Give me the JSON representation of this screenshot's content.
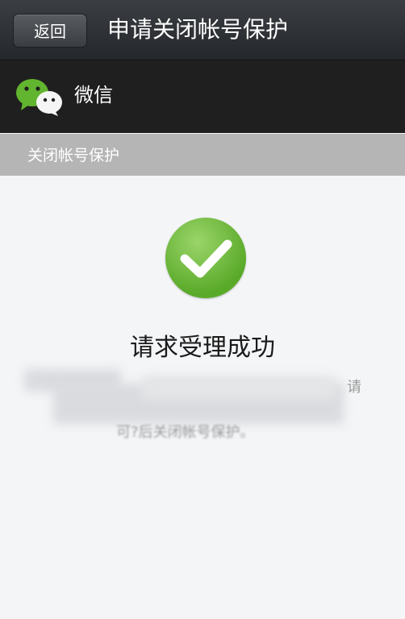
{
  "topbar": {
    "back_label": "返回",
    "title": "申请关闭帐号保护"
  },
  "appbar": {
    "app_name": "微信",
    "logo_icon": "wechat-logo-icon"
  },
  "section": {
    "label": "关闭帐号保护"
  },
  "result": {
    "icon": "check-circle-icon",
    "title": "请求受理成功",
    "desc_line1_tail": "请",
    "desc_line3": "可?后关闭帐号保护。"
  },
  "colors": {
    "accent_green": "#5aaa2a",
    "topbar": "#2e3135",
    "section_bar": "#b5b5b5"
  }
}
